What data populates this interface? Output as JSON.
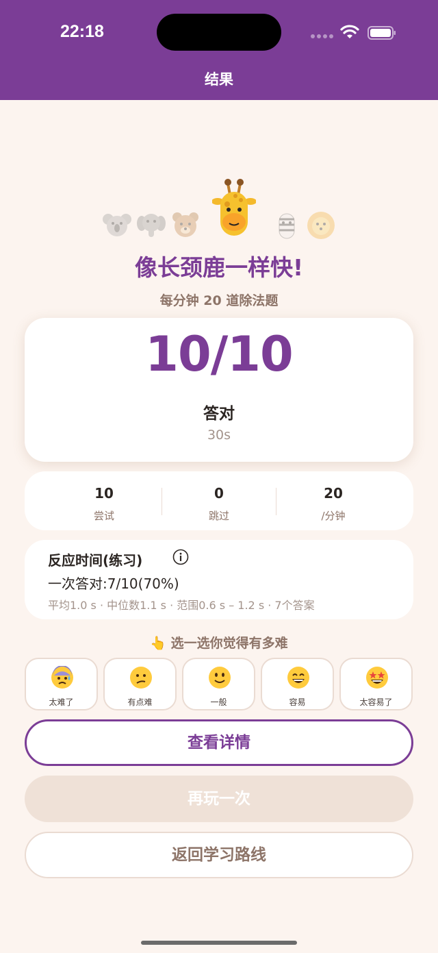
{
  "status_bar": {
    "time": "22:18"
  },
  "nav": {
    "title": "结果"
  },
  "headline": "像长颈鹿一样快!",
  "subline": "每分钟 20 道除法题",
  "score": {
    "value": "10/10",
    "label": "答对",
    "time": "30s"
  },
  "stats": [
    {
      "value": "10",
      "label": "尝试"
    },
    {
      "value": "0",
      "label": "跳过"
    },
    {
      "value": "20",
      "label": "/分钟"
    }
  ],
  "reaction": {
    "title": "反应时间(练习)",
    "first_try": "一次答对:7/10(70%)",
    "summary": "平均1.0 s · 中位数1.1 s · 范围0.6 s – 1.2 s · 7个答案"
  },
  "difficulty": {
    "prompt": "👆 选一选你觉得有多难",
    "options": [
      {
        "label": "太难了",
        "icon": "anxious-sweat-face-icon"
      },
      {
        "label": "有点难",
        "icon": "confused-face-icon"
      },
      {
        "label": "一般",
        "icon": "slight-smile-face-icon"
      },
      {
        "label": "容易",
        "icon": "grinning-face-icon"
      },
      {
        "label": "太容易了",
        "icon": "star-struck-face-icon"
      }
    ]
  },
  "buttons": {
    "details": "查看详情",
    "replay": "再玩一次",
    "back": "返回学习路线"
  },
  "colors": {
    "brand": "#7b3d96",
    "background": "#fcf4ef"
  }
}
